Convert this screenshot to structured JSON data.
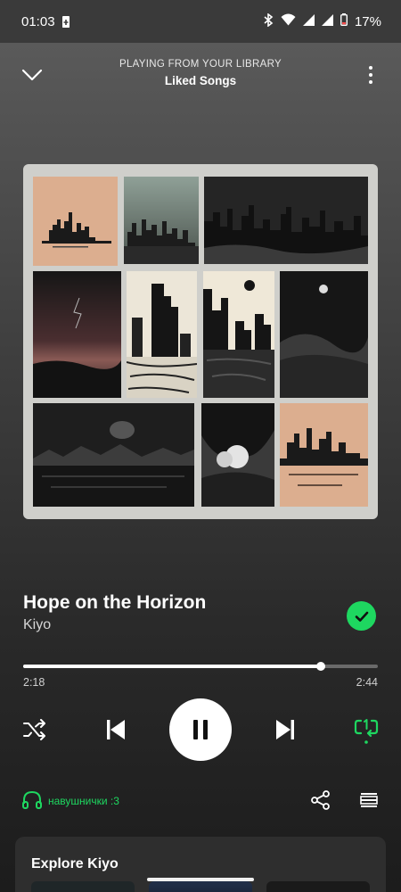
{
  "status_bar": {
    "time": "01:03",
    "battery_percent": "17%",
    "icons": [
      "battery-saver-icon",
      "bluetooth-icon",
      "wifi-icon",
      "signal-icon",
      "signal-icon",
      "battery-low-icon"
    ]
  },
  "header": {
    "context_label": "PLAYING FROM YOUR LIBRARY",
    "context_name": "Liked Songs",
    "icons": [
      "chevron-down-icon",
      "more-vertical-icon"
    ]
  },
  "track": {
    "title": "Hope on the Horizon",
    "artist": "Kiyo",
    "liked": true
  },
  "playback": {
    "elapsed": "2:18",
    "total": "2:44",
    "progress_fraction": 0.84,
    "is_playing": true,
    "repeat_mode": "repeat-one"
  },
  "device": {
    "name": "навушнички :3",
    "icon": "headphones-icon"
  },
  "explore": {
    "title": "Explore Kiyo"
  },
  "colors": {
    "accent": "#1ed760",
    "text": "#ffffff"
  }
}
